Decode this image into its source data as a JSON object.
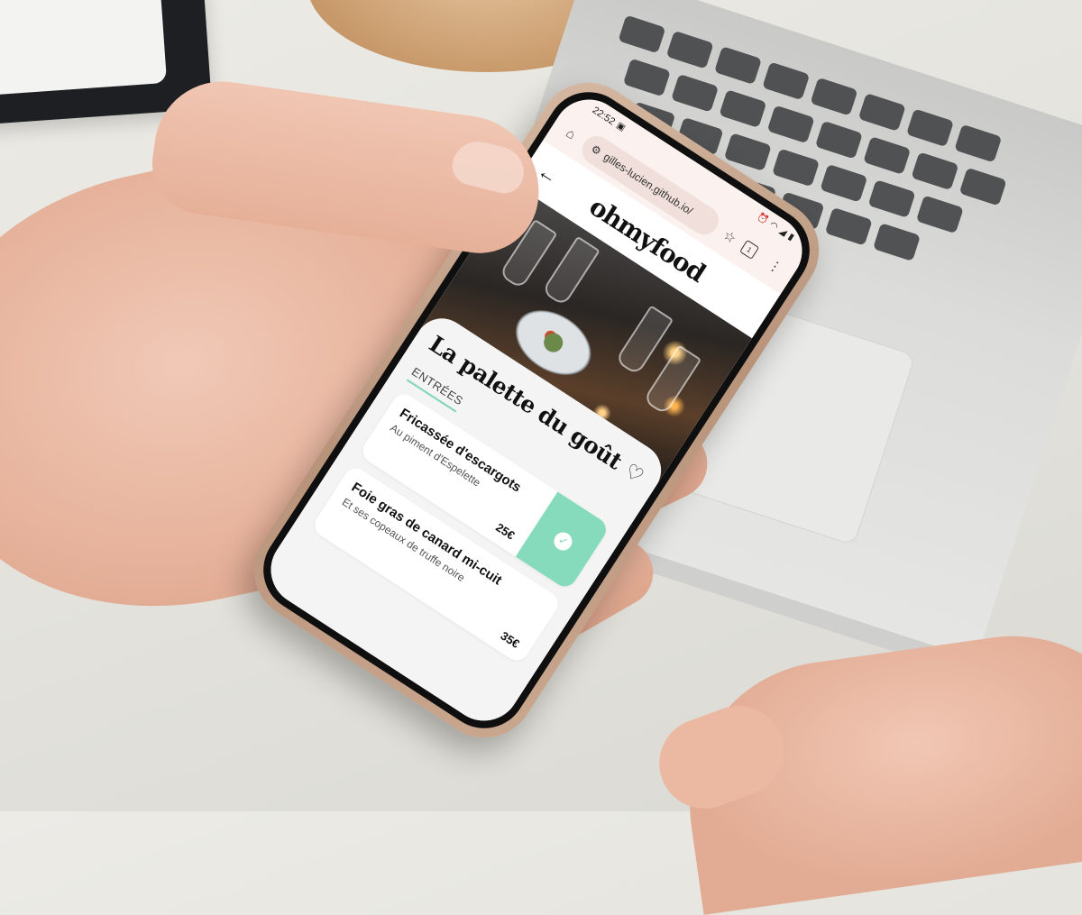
{
  "status_bar": {
    "time": "22:52",
    "icons": [
      "alarm-icon",
      "wifi-icon",
      "signal-icon",
      "battery-icon"
    ]
  },
  "browser": {
    "url": "gilles-lucien.github.io/",
    "icons": [
      "home-icon",
      "site-settings-icon",
      "bookmark-star-icon",
      "tabs-icon",
      "menu-icon"
    ]
  },
  "site": {
    "logo": "ohmyfood"
  },
  "restaurant": {
    "name": "La palette du goût",
    "section": "ENTRÉES",
    "dishes": [
      {
        "name": "Fricassée d'escargots",
        "description": "Au piment d'Espelette",
        "price": "25€",
        "selected": true
      },
      {
        "name": "Foie gras de canard mi-cuit",
        "description": "Et ses copeaux de truffe noire",
        "price": "35€",
        "selected": false
      }
    ]
  },
  "colors": {
    "accent": "#86dbbd",
    "browser_bg": "#fbf1ee"
  }
}
